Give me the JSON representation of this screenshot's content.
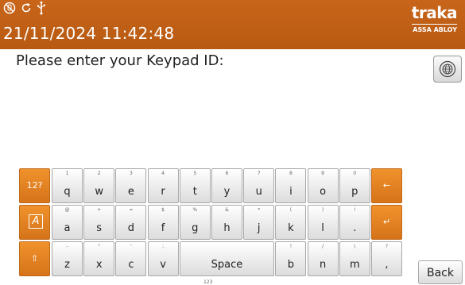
{
  "header": {
    "datetime": "21/11/2024 11:42:48",
    "brand": "traka",
    "brand_sub": "ASSA ABLOY",
    "status_icons": [
      "no-hand-icon",
      "refresh-icon",
      "usb-icon"
    ]
  },
  "prompt": "Please enter your Keypad ID:",
  "keyboard": {
    "row1": [
      {
        "main": "q",
        "sec": "1"
      },
      {
        "main": "w",
        "sec": "2"
      },
      {
        "main": "e",
        "sec": "3"
      },
      {
        "main": "r",
        "sec": "4"
      },
      {
        "main": "t",
        "sec": "5"
      },
      {
        "main": "y",
        "sec": "6"
      },
      {
        "main": "u",
        "sec": "7"
      },
      {
        "main": "i",
        "sec": "8"
      },
      {
        "main": "o",
        "sec": "9"
      },
      {
        "main": "p",
        "sec": "0"
      }
    ],
    "row2": [
      {
        "main": "a",
        "sec": "@"
      },
      {
        "main": "s",
        "sec": "+"
      },
      {
        "main": "d",
        "sec": "="
      },
      {
        "main": "f",
        "sec": "$"
      },
      {
        "main": "g",
        "sec": "%"
      },
      {
        "main": "h",
        "sec": "&"
      },
      {
        "main": "j",
        "sec": "*"
      },
      {
        "main": "k",
        "sec": "("
      },
      {
        "main": "l",
        "sec": ")"
      },
      {
        "main": ".",
        "sec": "!"
      }
    ],
    "row3_left": [
      {
        "main": "z",
        "sec": "-"
      },
      {
        "main": "x",
        "sec": "\""
      },
      {
        "main": "c",
        "sec": "'"
      },
      {
        "main": "v",
        "sec": ";"
      }
    ],
    "space": {
      "main": "Space",
      "sec": ""
    },
    "row3_right": [
      {
        "main": "b",
        "sec": "!"
      },
      {
        "main": "n",
        "sec": "/"
      },
      {
        "main": "m",
        "sec": "\\"
      },
      {
        "main": ",",
        "sec": "?"
      }
    ],
    "symbols_label": "12?",
    "caps_label": "A",
    "shift_label": "⇧",
    "backspace_label": "←",
    "enter_label": "↵",
    "below_space": "123"
  },
  "back_label": "Back",
  "colors": {
    "accent": "#c8651a",
    "key_orange": "#e8861f"
  }
}
